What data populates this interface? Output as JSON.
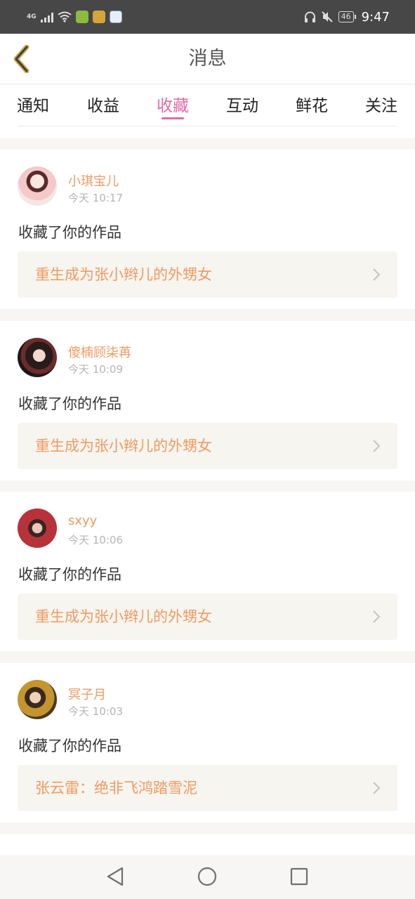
{
  "status_bar": {
    "network": "4G",
    "battery": "46",
    "time": "9:47",
    "icons": [
      "signal-icon",
      "wifi-icon",
      "app-icon",
      "app-icon",
      "app-icon",
      "headphones-icon",
      "mute-icon",
      "battery-icon"
    ]
  },
  "header": {
    "title": "消息",
    "back_icon": "chevron-left-icon"
  },
  "tabs": [
    {
      "label": "通知",
      "active": false
    },
    {
      "label": "收益",
      "active": false
    },
    {
      "label": "收藏",
      "active": true
    },
    {
      "label": "互动",
      "active": false
    },
    {
      "label": "鲜花",
      "active": false
    },
    {
      "label": "关注",
      "active": false
    }
  ],
  "messages": [
    {
      "user": "小琪宝儿",
      "time": "今天 10:17",
      "action": "收藏了你的作品",
      "work": "重生成为张小辫儿的外甥女"
    },
    {
      "user": "傻楠顾柒苒",
      "time": "今天 10:09",
      "action": "收藏了你的作品",
      "work": "重生成为张小辫儿的外甥女"
    },
    {
      "user": "sxyy",
      "time": "今天 10:06",
      "action": "收藏了你的作品",
      "work": "重生成为张小辫儿的外甥女"
    },
    {
      "user": "冥子月",
      "time": "今天 10:03",
      "action": "收藏了你的作品",
      "work": "张云雷：绝非飞鸿踏雪泥"
    }
  ],
  "colors": {
    "accent_tab": "#e26aa6",
    "username": "#f09a62",
    "work_title": "#f09a62",
    "work_bg": "#f6f5ef",
    "status_bar_bg": "#474747"
  },
  "system_nav": [
    "back-triangle-icon",
    "home-circle-icon",
    "recents-square-icon"
  ]
}
